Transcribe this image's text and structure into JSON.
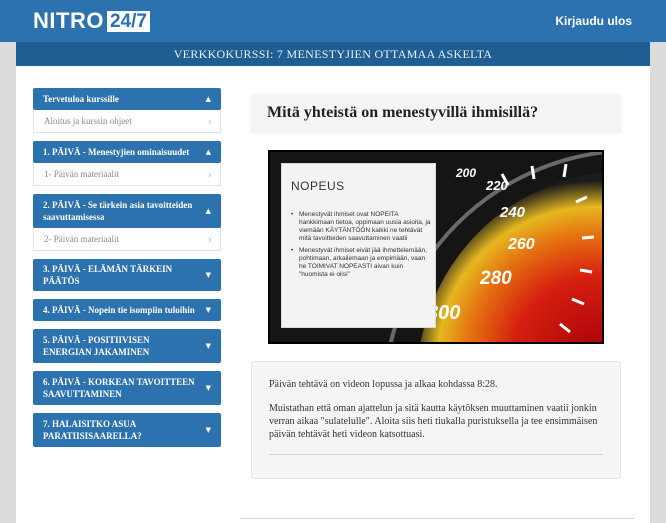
{
  "header": {
    "logo_text": "NITRO",
    "logo_box": "24/7",
    "logout_label": "Kirjaudu ulos"
  },
  "course_title": "VERKKOKURSSI: 7 MENESTYJIEN OTTAMAA ASKELTA",
  "sidebar": {
    "modules": [
      {
        "label": "Tervetuloa kurssille",
        "expanded": true,
        "items": [
          {
            "label": "Aloitus ja kurssin ohjeet"
          }
        ]
      },
      {
        "label": "1. PÄIVÄ - Menestyjien ominaisuudet",
        "expanded": true,
        "items": [
          {
            "label": "1- Päivän materiaalit"
          }
        ]
      },
      {
        "label": "2. PÄIVÄ - Se tärkein asia tavoitteiden saavuttamisessa",
        "expanded": true,
        "items": [
          {
            "label": "2- Päivän materiaalit"
          }
        ]
      },
      {
        "label": "3. PÄIVÄ - ELÄMÄN TÄRKEIN PÄÄTÖS",
        "expanded": false,
        "items": []
      },
      {
        "label": "4. PÄIVÄ - Nopein tie isompiin tuloihin",
        "expanded": false,
        "items": []
      },
      {
        "label": "5. PÄIVÄ - POSITIIVISEN ENERGIAN JAKAMINEN",
        "expanded": false,
        "items": []
      },
      {
        "label": "6. PÄIVÄ - KORKEAN TAVOITTEEN SAAVUTTAMINEN",
        "expanded": false,
        "items": []
      },
      {
        "label": "7. HALAISITKO ASUA PARATIISISAARELLA?",
        "expanded": false,
        "items": []
      }
    ]
  },
  "main": {
    "lesson_title": "Mitä yhteistä on menestyvillä ihmisillä?",
    "video": {
      "slide_title": "NOPEUS",
      "bullets": [
        "Menestyvät ihmiset ovat NOPEITA hankkimaan tietoa, oppimaan uusia asioita, ja viemään KÄYTÄNTÖÖN kaikki ne tehtävät mitä tavoitteiden saavuttaminen vaatii",
        "Menestyvät ihmiset eivät jää ihmettelemään, pohtimaan, arkailemaan ja empimään, vaan he TOIMIVAT NOPEASTI aivan kuin \"huomista ei olisi\""
      ],
      "gauge_labels": [
        "200",
        "220",
        "240",
        "260",
        "280",
        "300"
      ]
    },
    "task": {
      "paragraph1": "Päivän tehtävä on videon lopussa ja alkaa kohdassa 8:28.",
      "paragraph2": "Muistathan että oman ajattelun ja sitä kautta käytöksen muuttaminen vaatii jonkin verran aikaa \"sulatelulle\". Aloita siis heti tiukalla puristuksella ja tee ensimmäisen päivän tehtävät heti videon katsottuasi."
    }
  },
  "colors": {
    "primary": "#2c72ae",
    "subbar": "#1f5e92"
  }
}
